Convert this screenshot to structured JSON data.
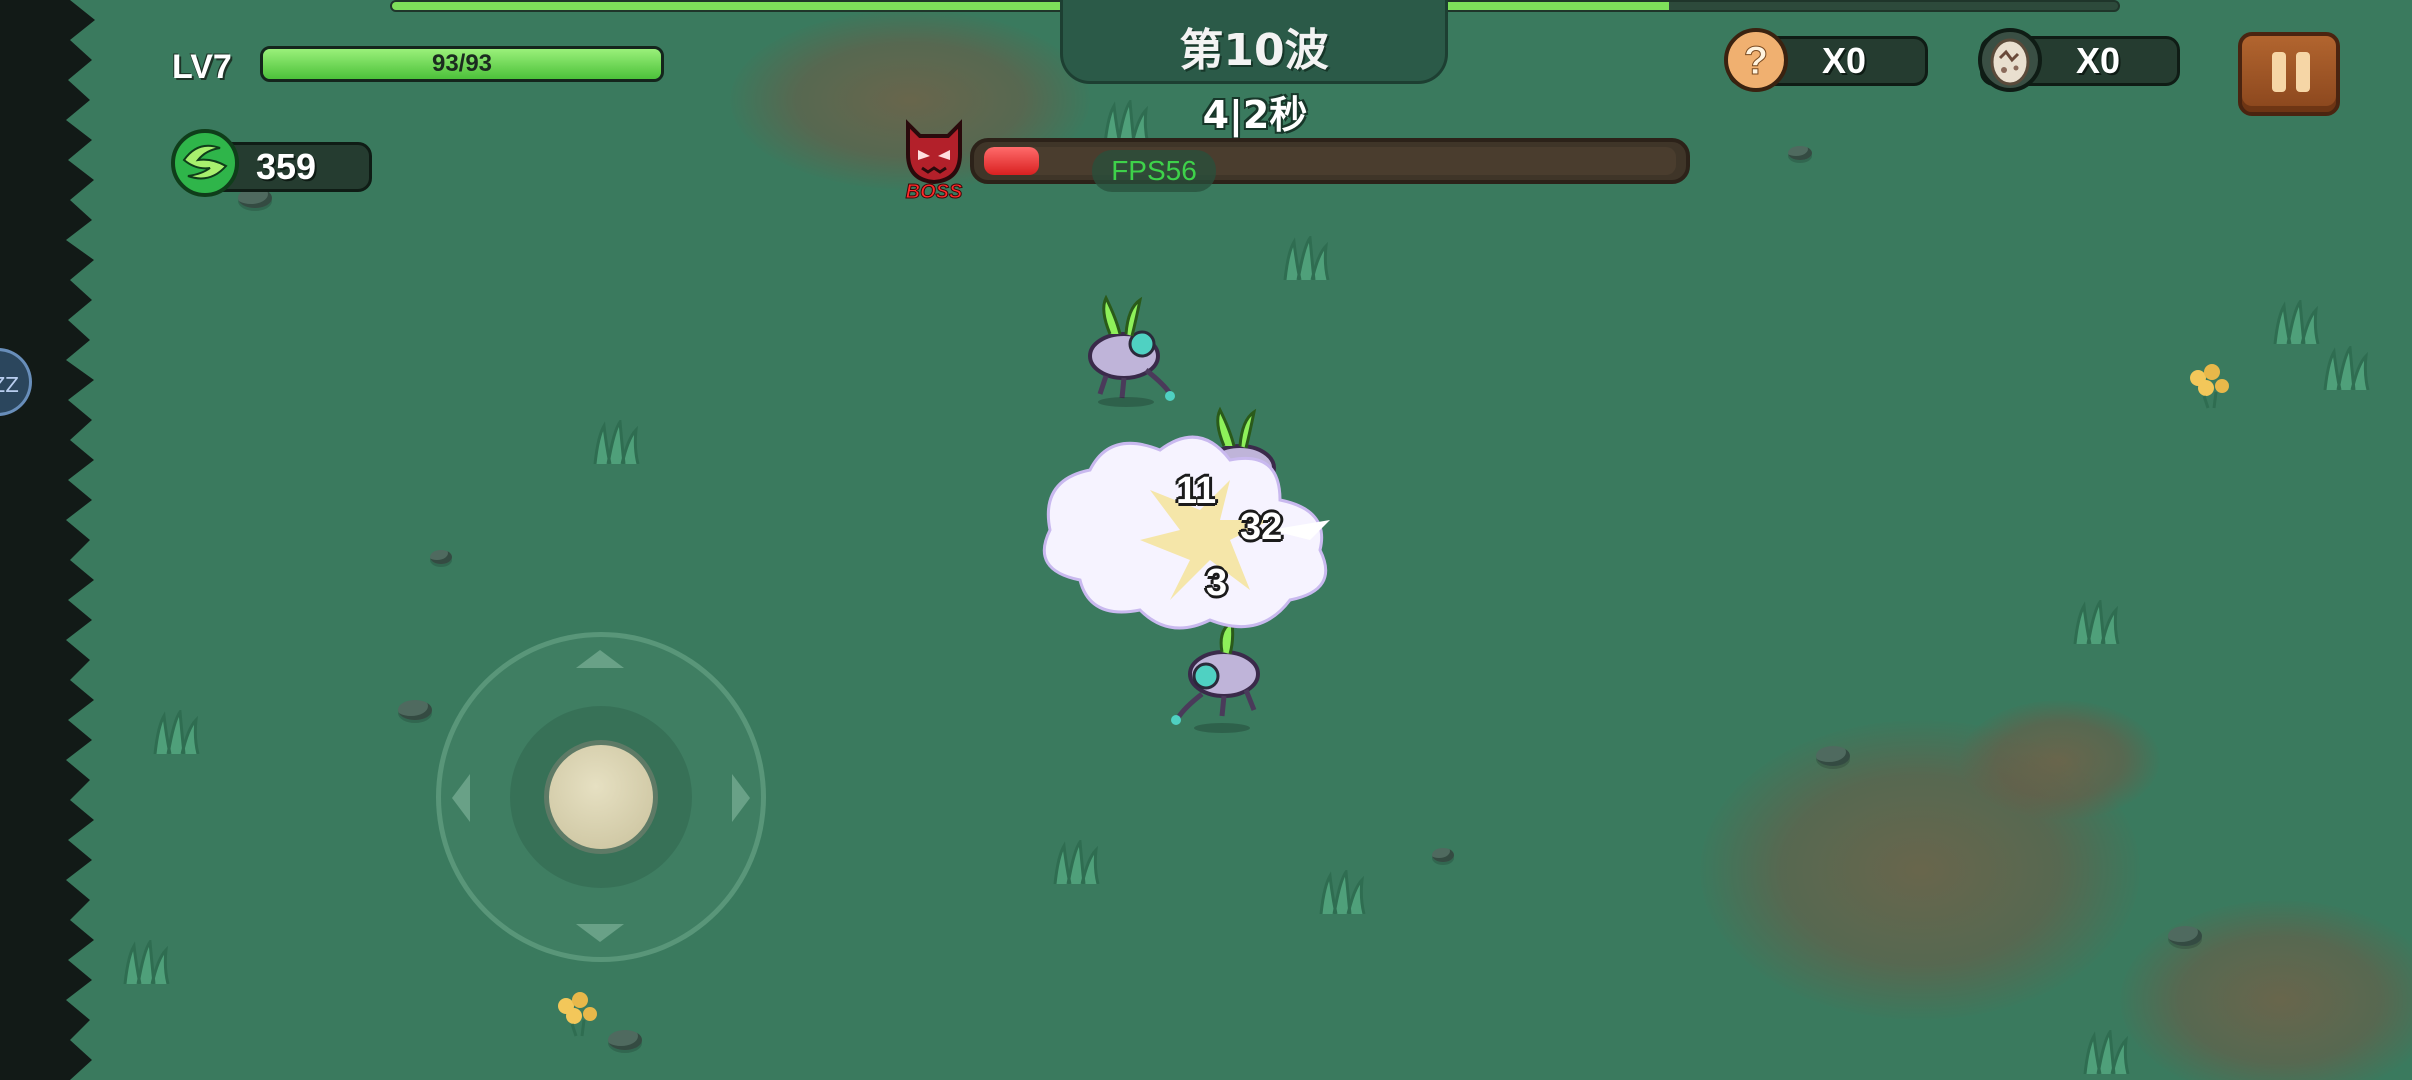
{
  "hud": {
    "level_label": "LV7",
    "hp_text": "93/93",
    "hp_fraction": 1.0,
    "gem_count": "359",
    "wave_title": "第10波",
    "wave_timer": "4|2秒",
    "wave_progress_fraction": 0.74,
    "boss_label": "BOSS",
    "boss_hp_fraction": 0.08,
    "fps_label": "FPS56",
    "mystery_count": "X0",
    "egg_count": "X0",
    "side_button_label": "ZZ"
  },
  "combat": {
    "damage_numbers": [
      "11",
      "32",
      "3"
    ]
  },
  "icons": {
    "gem": "green-swirl-gem-icon",
    "mystery": "question-mark-icon",
    "egg": "monster-egg-icon",
    "boss": "demon-face-icon",
    "pause": "pause-icon"
  },
  "colors": {
    "ground": "#3a7a5e",
    "hp_fill": "#4cc13a",
    "boss_fill": "#d92020",
    "fps_text": "#3ed24a",
    "pause_button": "#8a461d"
  }
}
